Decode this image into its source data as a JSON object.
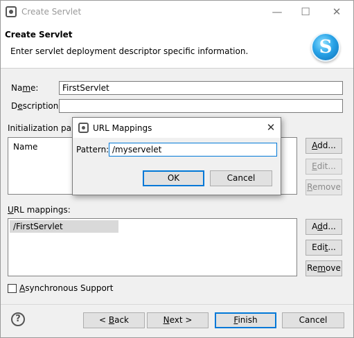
{
  "window": {
    "title": "Create Servlet",
    "minimize_glyph": "—",
    "maximize_glyph": "☐",
    "close_glyph": "✕"
  },
  "header": {
    "title": "Create Servlet",
    "description": "Enter servlet deployment descriptor specific information.",
    "logo_letter": "S"
  },
  "form": {
    "name_label_pre": "Na",
    "name_label_u": "m",
    "name_label_post": "e:",
    "name_value": "FirstServlet",
    "description_label_pre": "D",
    "description_label_u": "e",
    "description_label_post": "scription:",
    "description_value": "",
    "init_params_label": "Initialization para",
    "init_params_column": "Name",
    "url_mappings_label_pre": "",
    "url_mappings_label_u": "U",
    "url_mappings_label_post": "RL mappings:",
    "url_mappings": [
      "/FirstServlet"
    ],
    "async_label_pre": "",
    "async_label_u": "A",
    "async_label_post": "synchronous Support",
    "async_checked": false
  },
  "init_buttons": {
    "add": {
      "pre": "",
      "u": "A",
      "post": "dd..."
    },
    "edit": {
      "pre": "",
      "u": "E",
      "post": "dit..."
    },
    "remove": {
      "pre": "",
      "u": "R",
      "post": "emove"
    }
  },
  "url_buttons": {
    "add": {
      "pre": "A",
      "u": "d",
      "post": "d..."
    },
    "edit": {
      "pre": "Edi",
      "u": "t",
      "post": "..."
    },
    "remove": {
      "pre": "Re",
      "u": "m",
      "post": "ove"
    }
  },
  "footer": {
    "help_glyph": "?",
    "back": {
      "pre": "< ",
      "u": "B",
      "post": "ack"
    },
    "next": {
      "pre": "",
      "u": "N",
      "post": "ext >"
    },
    "finish": {
      "pre": "",
      "u": "F",
      "post": "inish"
    },
    "cancel": "Cancel"
  },
  "dialog": {
    "title": "URL Mappings",
    "close_glyph": "✕",
    "pattern_label": "Pattern:",
    "pattern_value": "/myservelet",
    "ok": "OK",
    "cancel": "Cancel"
  }
}
